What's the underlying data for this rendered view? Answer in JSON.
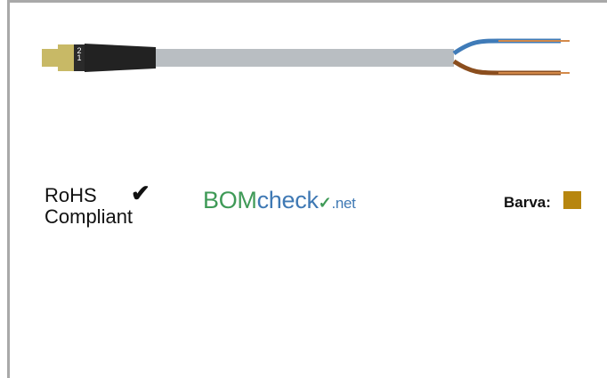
{
  "rohs": {
    "line1": "RoHS",
    "line2": "Compliant",
    "check": "✔"
  },
  "bomcheck": {
    "part1": "BOM",
    "part2": "check",
    "part3": ".net"
  },
  "color": {
    "label": "Barva:",
    "swatch": "#b7860f"
  },
  "connector": {
    "pin1": "1",
    "pin2": "2"
  }
}
